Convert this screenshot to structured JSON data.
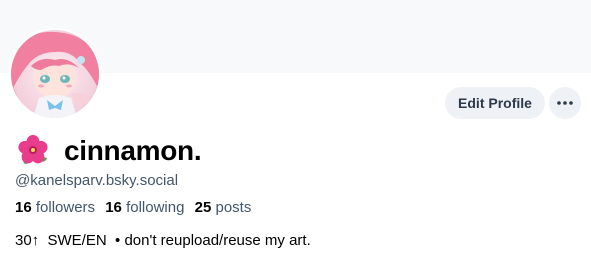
{
  "profile": {
    "display_name": "cinnamon.",
    "handle": "@kanelsparv.bsky.social",
    "bio": "30↑  SWE/EN  • don't reupload/reuse my art.",
    "avatar_icon": "anime-avatar-image",
    "name_icon": "hibiscus-flower-icon"
  },
  "stats": {
    "followers_count": "16",
    "followers_label": "followers",
    "following_count": "16",
    "following_label": "following",
    "posts_count": "25",
    "posts_label": "posts"
  },
  "actions": {
    "edit_profile_label": "Edit Profile",
    "more_icon": "ellipsis-icon"
  },
  "colors": {
    "banner": "#f8f9fb",
    "button_bg": "#eef1f5",
    "secondary_text": "#42576c"
  }
}
